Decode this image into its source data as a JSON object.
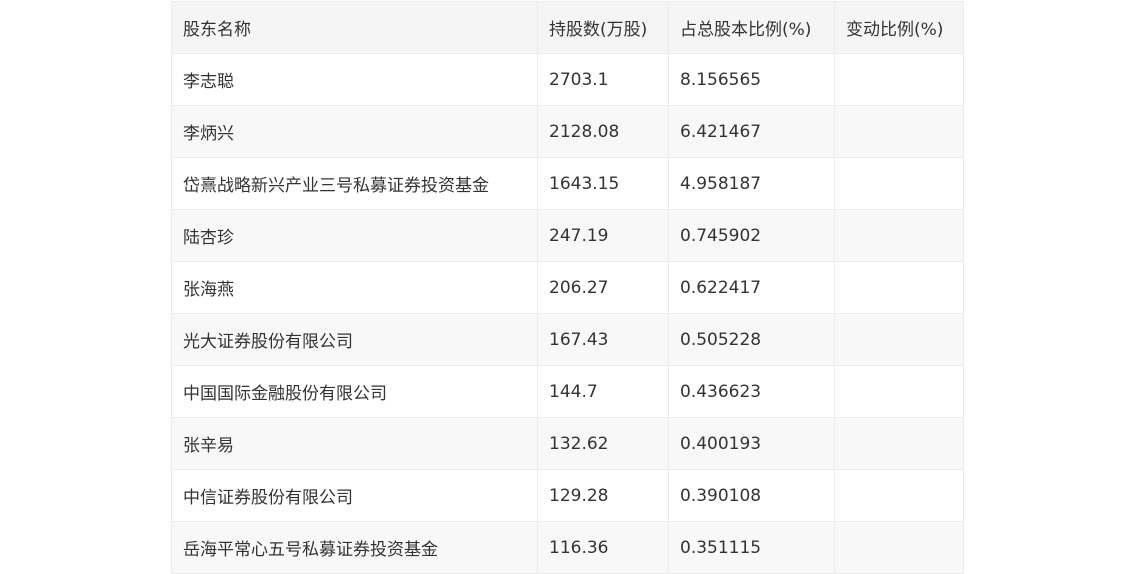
{
  "table": {
    "headers": [
      "股东名称",
      "持股数(万股)",
      "占总股本比例(%)",
      "变动比例(%)"
    ],
    "rows": [
      [
        "李志聪",
        "2703.1",
        "8.156565",
        ""
      ],
      [
        "李炳兴",
        "2128.08",
        "6.421467",
        ""
      ],
      [
        "岱熹战略新兴产业三号私募证券投资基金",
        "1643.15",
        "4.958187",
        ""
      ],
      [
        "陆杏珍",
        "247.19",
        "0.745902",
        ""
      ],
      [
        "张海燕",
        "206.27",
        "0.622417",
        ""
      ],
      [
        "光大证券股份有限公司",
        "167.43",
        "0.505228",
        ""
      ],
      [
        "中国国际金融股份有限公司",
        "144.7",
        "0.436623",
        ""
      ],
      [
        "张辛易",
        "132.62",
        "0.400193",
        ""
      ],
      [
        "中信证券股份有限公司",
        "129.28",
        "0.390108",
        ""
      ],
      [
        "岳海平常心五号私募证券投资基金",
        "116.36",
        "0.351115",
        ""
      ]
    ]
  }
}
